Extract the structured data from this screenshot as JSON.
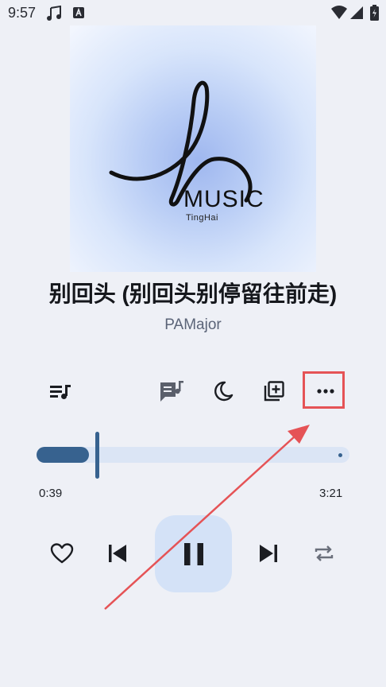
{
  "status_bar": {
    "time": "9:57",
    "icons": [
      "music-note-icon",
      "font-a-icon",
      "wifi-icon",
      "signal-icon",
      "battery-charging-icon"
    ]
  },
  "album": {
    "logo_text": "MUSIC",
    "logo_subtext": "TingHai"
  },
  "song": {
    "title": "别回头 (别回头别停留往前走)",
    "artist": "PAMajor"
  },
  "actions": {
    "queue_icon": "playlist-icon",
    "lyrics_icon": "lyrics-icon",
    "sleep_icon": "moon-icon",
    "add_icon": "add-to-playlist-icon",
    "more_icon": "more-horizontal-icon"
  },
  "progress": {
    "current": "0:39",
    "total": "3:21",
    "fraction": 0.19
  },
  "controls": {
    "like_icon": "heart-icon",
    "prev_icon": "skip-previous-icon",
    "play_state": "pause-icon",
    "next_icon": "skip-next-icon",
    "repeat_icon": "repeat-icon"
  },
  "colors": {
    "background": "#eef0f6",
    "accent": "#37628f",
    "track": "#dbe5f5",
    "pause_bg": "#d4e2f7",
    "highlight": "#e55356"
  }
}
